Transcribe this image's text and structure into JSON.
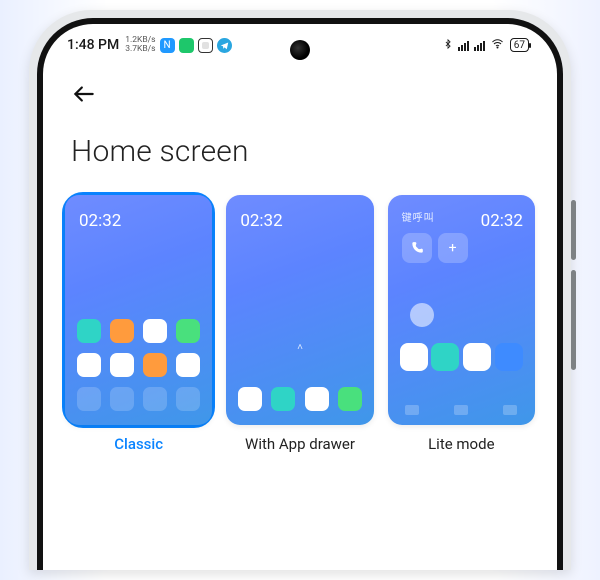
{
  "status": {
    "time": "1:48 PM",
    "net_up": "1.2KB/s",
    "net_down": "3.7KB/s",
    "battery": "67",
    "bt_glyph": "⁕"
  },
  "page": {
    "title": "Home screen"
  },
  "previews": {
    "classic_time": "02:32",
    "drawer_time": "02:32",
    "lite_time": "02:32",
    "lite_cn": "键呼叫"
  },
  "options": {
    "classic": "Classic",
    "drawer": "With App drawer",
    "lite": "Lite mode"
  },
  "colors": {
    "accent": "#0a84ff"
  }
}
